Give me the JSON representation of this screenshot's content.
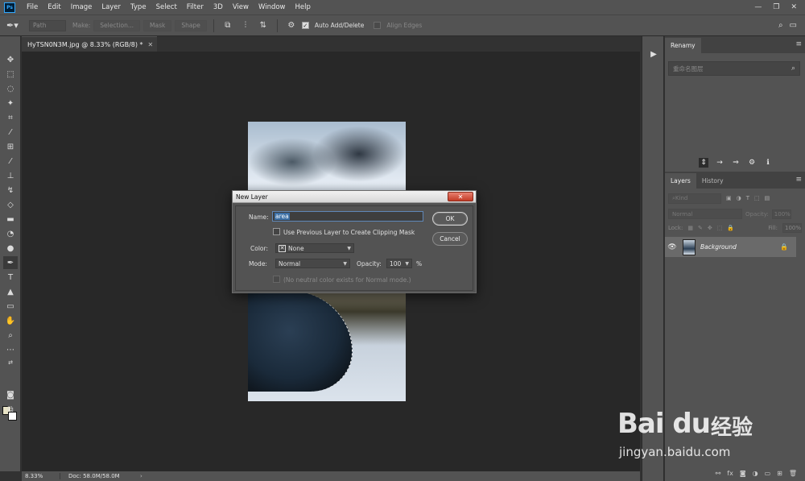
{
  "menu": {
    "items": [
      "File",
      "Edit",
      "Image",
      "Layer",
      "Type",
      "Select",
      "Filter",
      "3D",
      "View",
      "Window",
      "Help"
    ],
    "logo": "Ps",
    "window_controls": [
      "—",
      "❐",
      "✕"
    ]
  },
  "options_bar": {
    "tool_icon": "pen-icon",
    "mode": "Path",
    "make_label": "Make:",
    "selection_btn": "Selection...",
    "mask_btn": "Mask",
    "shape_btn": "Shape",
    "auto_add_delete": "Auto Add/Delete",
    "auto_add_delete_checked": true,
    "align_edges": "Align Edges",
    "align_edges_checked": false
  },
  "document": {
    "tab_title": "HyTSN0N3M.jpg @ 8.33% (RGB/8) *",
    "zoom": "8.33%",
    "doc_info": "Doc: 58.0M/58.0M"
  },
  "renamy": {
    "tab": "Renamy",
    "search_placeholder": "重命名图层"
  },
  "layers": {
    "tabs": [
      "Layers",
      "History"
    ],
    "kind_label": "Kind",
    "blend_mode": "Normal",
    "opacity_label": "Opacity:",
    "opacity_value": "100%",
    "lock_label": "Lock:",
    "fill_label": "Fill:",
    "fill_value": "100%",
    "items": [
      {
        "name": "Background",
        "visible": true,
        "locked": true
      }
    ]
  },
  "dialog": {
    "title": "New Layer",
    "name_label": "Name:",
    "name_value": "area",
    "clipping_label": "Use Previous Layer to Create Clipping Mask",
    "color_label": "Color:",
    "color_value": "None",
    "mode_label": "Mode:",
    "mode_value": "Normal",
    "opacity_label": "Opacity:",
    "opacity_value": "100",
    "opacity_unit": "%",
    "neutral_note": "(No neutral color exists for Normal mode.)",
    "ok": "OK",
    "cancel": "Cancel"
  },
  "watermark": {
    "logo": "Bai du",
    "cn": "经验",
    "url": "jingyan.baidu.com"
  },
  "colors": {
    "foreground": "#e8e3c6",
    "background": "#ffffff",
    "accent": "#31a8ff"
  }
}
